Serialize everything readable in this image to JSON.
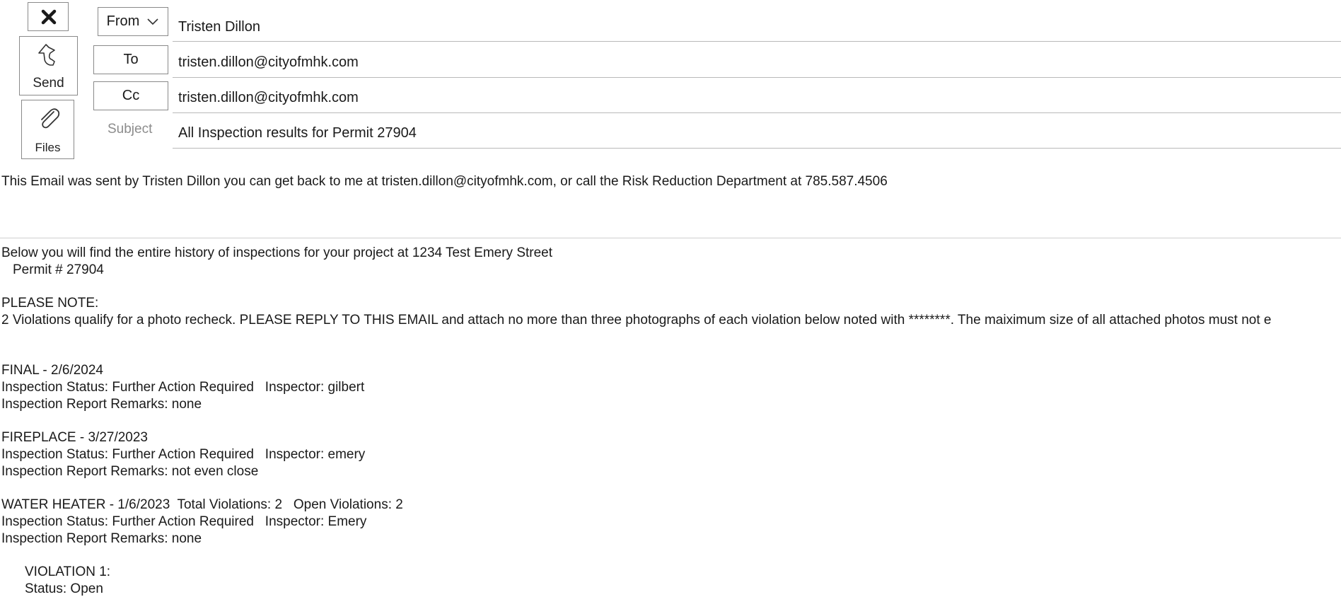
{
  "toolbar": {
    "close_label": "",
    "send_label": "Send",
    "files_label": "Files"
  },
  "header": {
    "from_label": "From",
    "from_value": "Tristen Dillon",
    "to_label": "To",
    "to_value": "tristen.dillon@cityofmhk.com",
    "cc_label": "Cc",
    "cc_value": "tristen.dillon@cityofmhk.com",
    "subject_label": "Subject",
    "subject_value": "All Inspection results for Permit 27904"
  },
  "signature": "This Email was sent by Tristen Dillon you can get back to me at tristen.dillon@cityofmhk.com, or call the Risk Reduction Department at 785.587.4506",
  "body": {
    "intro": "Below you will find the entire history of inspections for your project at 1234 Test Emery Street",
    "permit": "Permit # 27904",
    "note_heading": "PLEASE NOTE:",
    "note_text": "2 Violations qualify for a photo recheck. PLEASE REPLY TO THIS EMAIL and attach no more than three photographs of each violation below noted with ********. The maiximum size of all attached photos must not e",
    "inspections": [
      {
        "title": "FINAL - 2/6/2024",
        "status": "Inspection Status: Further Action Required   Inspector: gilbert",
        "remarks": "Inspection Report Remarks: none"
      },
      {
        "title": "FIREPLACE - 3/27/2023",
        "status": "Inspection Status: Further Action Required   Inspector: emery",
        "remarks": "Inspection Report Remarks: not even close"
      },
      {
        "title": "WATER HEATER - 1/6/2023  Total Violations: 2   Open Violations: 2",
        "status": "Inspection Status: Further Action Required   Inspector: Emery",
        "remarks": "Inspection Report Remarks: none"
      }
    ],
    "violation_heading": "VIOLATION 1:",
    "violation_status": "Status: Open"
  },
  "icons": {
    "close": "close-x-icon",
    "send": "send-arrow-icon",
    "files": "paperclip-icon",
    "from_dropdown": "chevron-down-icon"
  },
  "colors": {
    "border": "#8a8a8a",
    "divider": "#b9b9b9",
    "muted_label": "#8c8c8c"
  }
}
